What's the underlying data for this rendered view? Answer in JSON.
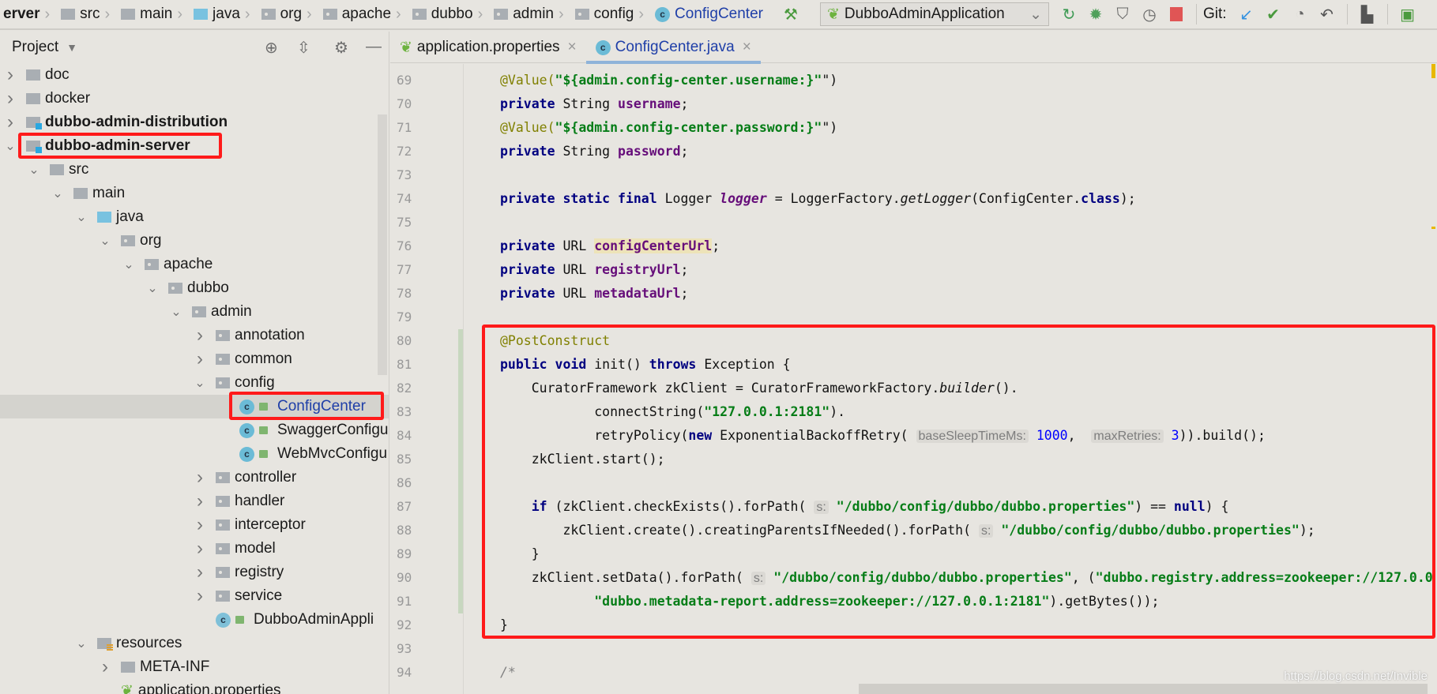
{
  "breadcrumb": [
    {
      "label": "erver",
      "icon": "none",
      "bold": true
    },
    {
      "label": "src",
      "icon": "folder"
    },
    {
      "label": "main",
      "icon": "folder"
    },
    {
      "label": "java",
      "icon": "source-folder"
    },
    {
      "label": "org",
      "icon": "package"
    },
    {
      "label": "apache",
      "icon": "package"
    },
    {
      "label": "dubbo",
      "icon": "package"
    },
    {
      "label": "admin",
      "icon": "package"
    },
    {
      "label": "config",
      "icon": "package"
    },
    {
      "label": "ConfigCenter",
      "icon": "class"
    }
  ],
  "toolbar": {
    "run_config": "DubboAdminApplication",
    "git_label": "Git:"
  },
  "project": {
    "title": "Project"
  },
  "tree": [
    {
      "label": "doc",
      "level": 0,
      "arrow": "right",
      "icon": "folder"
    },
    {
      "label": "docker",
      "level": 0,
      "arrow": "right",
      "icon": "folder"
    },
    {
      "label": "dubbo-admin-distribution",
      "level": 0,
      "arrow": "right",
      "icon": "module",
      "bold": true
    },
    {
      "label": "dubbo-admin-server",
      "level": 0,
      "arrow": "down",
      "icon": "module",
      "bold": true
    },
    {
      "label": "src",
      "level": 1,
      "arrow": "down",
      "icon": "folder"
    },
    {
      "label": "main",
      "level": 2,
      "arrow": "down",
      "icon": "folder"
    },
    {
      "label": "java",
      "level": 3,
      "arrow": "down",
      "icon": "source-folder"
    },
    {
      "label": "org",
      "level": 4,
      "arrow": "down",
      "icon": "package"
    },
    {
      "label": "apache",
      "level": 5,
      "arrow": "down",
      "icon": "package"
    },
    {
      "label": "dubbo",
      "level": 6,
      "arrow": "down",
      "icon": "package"
    },
    {
      "label": "admin",
      "level": 7,
      "arrow": "down",
      "icon": "package"
    },
    {
      "label": "annotation",
      "level": 8,
      "arrow": "right",
      "icon": "package"
    },
    {
      "label": "common",
      "level": 8,
      "arrow": "right",
      "icon": "package"
    },
    {
      "label": "config",
      "level": 8,
      "arrow": "down",
      "icon": "package"
    },
    {
      "label": "ConfigCenter",
      "level": 9,
      "arrow": "none",
      "icon": "class",
      "selected": true
    },
    {
      "label": "SwaggerConfigu",
      "level": 9,
      "arrow": "none",
      "icon": "class"
    },
    {
      "label": "WebMvcConfigu",
      "level": 9,
      "arrow": "none",
      "icon": "class"
    },
    {
      "label": "controller",
      "level": 8,
      "arrow": "right",
      "icon": "package"
    },
    {
      "label": "handler",
      "level": 8,
      "arrow": "right",
      "icon": "package"
    },
    {
      "label": "interceptor",
      "level": 8,
      "arrow": "right",
      "icon": "package"
    },
    {
      "label": "model",
      "level": 8,
      "arrow": "right",
      "icon": "package"
    },
    {
      "label": "registry",
      "level": 8,
      "arrow": "right",
      "icon": "package"
    },
    {
      "label": "service",
      "level": 8,
      "arrow": "right",
      "icon": "package"
    },
    {
      "label": "DubboAdminAppli",
      "level": 8,
      "arrow": "none",
      "icon": "spring-class"
    },
    {
      "label": "resources",
      "level": 3,
      "arrow": "down",
      "icon": "resources-folder"
    },
    {
      "label": "META-INF",
      "level": 4,
      "arrow": "right",
      "icon": "folder"
    },
    {
      "label": "application.properties",
      "level": 4,
      "arrow": "none",
      "icon": "properties"
    }
  ],
  "tabs": [
    {
      "label": "application.properties",
      "icon": "spring-properties",
      "active": false
    },
    {
      "label": "ConfigCenter.java",
      "icon": "class",
      "active": true
    }
  ],
  "code": [
    {
      "n": "69",
      "t": [
        [
          "ann",
          "@Value("
        ],
        [
          "str",
          "\"${admin.config-center.username:}\""
        ],
        [
          "",
          "\")"
        ]
      ]
    },
    {
      "n": "70",
      "t": [
        [
          "kw",
          "private "
        ],
        [
          "",
          "String "
        ],
        [
          "fld",
          "username"
        ],
        [
          "",
          ";"
        ]
      ]
    },
    {
      "n": "71",
      "t": [
        [
          "ann",
          "@Value("
        ],
        [
          "str",
          "\"${admin.config-center.password:}\""
        ],
        [
          "",
          "\")"
        ]
      ]
    },
    {
      "n": "72",
      "t": [
        [
          "kw",
          "private "
        ],
        [
          "",
          "String "
        ],
        [
          "fld",
          "password"
        ],
        [
          "",
          ";"
        ]
      ]
    },
    {
      "n": "73",
      "t": []
    },
    {
      "n": "74",
      "t": [
        [
          "kw",
          "private static final "
        ],
        [
          "",
          "Logger "
        ],
        [
          "fldi",
          "logger"
        ],
        [
          "",
          " = LoggerFactory."
        ],
        [
          "it",
          "getLogger"
        ],
        [
          "",
          "(ConfigCenter."
        ],
        [
          "kw",
          "class"
        ],
        [
          "",
          ");"
        ]
      ]
    },
    {
      "n": "75",
      "t": []
    },
    {
      "n": "76",
      "t": [
        [
          "kw",
          "private "
        ],
        [
          "",
          "URL "
        ],
        [
          "fld hl",
          "configCenterUrl"
        ],
        [
          "",
          ";"
        ]
      ]
    },
    {
      "n": "77",
      "t": [
        [
          "kw",
          "private "
        ],
        [
          "",
          "URL "
        ],
        [
          "fld",
          "registryUrl"
        ],
        [
          "",
          ";"
        ]
      ]
    },
    {
      "n": "78",
      "t": [
        [
          "kw",
          "private "
        ],
        [
          "",
          "URL "
        ],
        [
          "fld",
          "metadataUrl"
        ],
        [
          "",
          ";"
        ]
      ]
    },
    {
      "n": "79",
      "t": []
    },
    {
      "n": "80",
      "t": [
        [
          "ann",
          "@PostConstruct"
        ]
      ]
    },
    {
      "n": "81",
      "t": [
        [
          "kw",
          "public void "
        ],
        [
          "",
          "init() "
        ],
        [
          "kw",
          "throws "
        ],
        [
          "",
          "Exception {"
        ]
      ]
    },
    {
      "n": "82",
      "t": [
        [
          "",
          "    CuratorFramework zkClient = CuratorFrameworkFactory."
        ],
        [
          "it",
          "builder"
        ],
        [
          "",
          "()."
        ]
      ]
    },
    {
      "n": "83",
      "t": [
        [
          "",
          "            connectString("
        ],
        [
          "str",
          "\"127.0.0.1:2181\""
        ],
        [
          "",
          ")."
        ]
      ]
    },
    {
      "n": "84",
      "t": [
        [
          "",
          "            retryPolicy("
        ],
        [
          "kw",
          "new "
        ],
        [
          "",
          "ExponentialBackoffRetry( "
        ],
        [
          "hint",
          "baseSleepTimeMs:"
        ],
        [
          "num",
          " 1000"
        ],
        [
          "",
          ",  "
        ],
        [
          "hint",
          "maxRetries:"
        ],
        [
          "num",
          " 3"
        ],
        [
          "",
          "))."
        ],
        [
          "",
          "build();"
        ]
      ]
    },
    {
      "n": "85",
      "t": [
        [
          "",
          "    zkClient.start();"
        ]
      ]
    },
    {
      "n": "86",
      "t": []
    },
    {
      "n": "87",
      "t": [
        [
          "kw",
          "    if "
        ],
        [
          "",
          "(zkClient.checkExists().forPath( "
        ],
        [
          "hint",
          "s:"
        ],
        [
          "str",
          " \"/dubbo/config/dubbo/dubbo.properties\""
        ],
        [
          "",
          ") == "
        ],
        [
          "kw",
          "null"
        ],
        [
          "",
          ") {"
        ]
      ]
    },
    {
      "n": "88",
      "t": [
        [
          "",
          "        zkClient.create().creatingParentsIfNeeded().forPath( "
        ],
        [
          "hint",
          "s:"
        ],
        [
          "str",
          " \"/dubbo/config/dubbo/dubbo.properties\""
        ],
        [
          "",
          ");"
        ]
      ]
    },
    {
      "n": "89",
      "t": [
        [
          "",
          "    }"
        ]
      ]
    },
    {
      "n": "90",
      "t": [
        [
          "",
          "    zkClient.setData().forPath( "
        ],
        [
          "hint",
          "s:"
        ],
        [
          "str",
          " \"/dubbo/config/dubbo/dubbo.properties\""
        ],
        [
          "",
          ", ("
        ],
        [
          "str",
          "\"dubbo.registry.address=zookeeper://127.0.0"
        ]
      ]
    },
    {
      "n": "91",
      "t": [
        [
          "",
          "            "
        ],
        [
          "str",
          "\"dubbo.metadata-report.address=zookeeper://127.0.0.1:2181\""
        ],
        [
          "",
          ").getBytes());"
        ]
      ]
    },
    {
      "n": "92",
      "t": [
        [
          "",
          "}"
        ]
      ]
    },
    {
      "n": "93",
      "t": []
    },
    {
      "n": "94",
      "t": [
        [
          "cm",
          "/*"
        ]
      ]
    }
  ],
  "watermark": {
    "logo": "Totoro",
    "url": "https://blog.csdn.net/Invible"
  },
  "colors": {
    "highlight_box": "#ff1a1a",
    "keyword": "#000080",
    "string": "#067d17",
    "annotation": "#808000",
    "field": "#660e7a",
    "number": "#0000ff"
  }
}
